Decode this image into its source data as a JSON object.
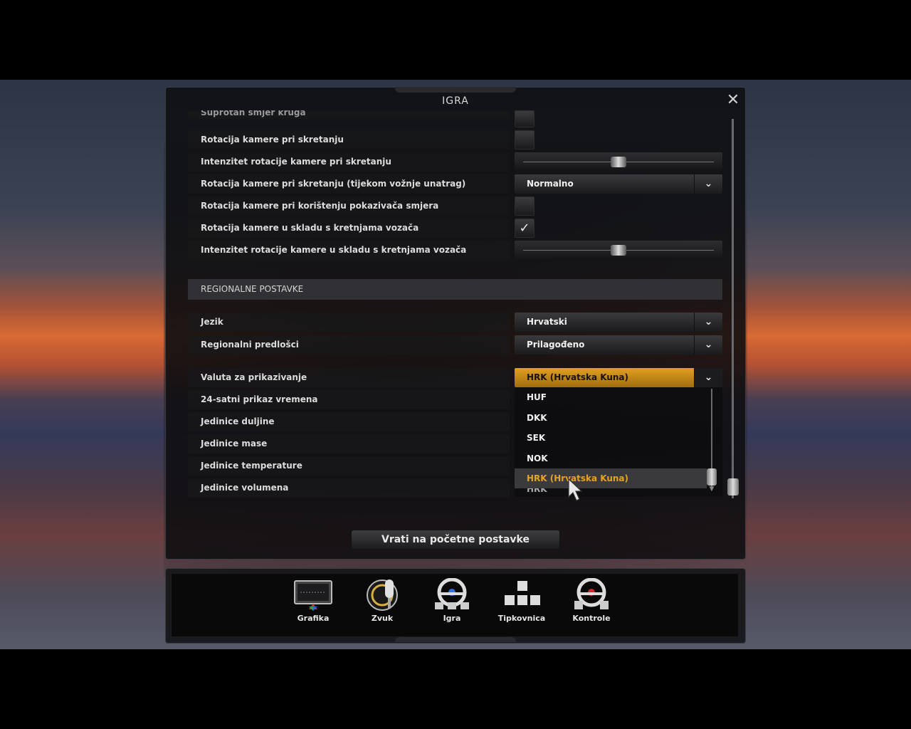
{
  "dialog": {
    "title": "IGRA",
    "close_label": "✕"
  },
  "rows": {
    "partial_label": "Suprotan smjer kruga",
    "camera_turn": "Rotacija kamere pri skretanju",
    "camera_turn_intensity": "Intenzitet rotacije kamere pri skretanju",
    "camera_turn_reverse": "Rotacija kamere pri skretanju (tijekom vožnje unatrag)",
    "camera_turn_reverse_value": "Normalno",
    "camera_blinker": "Rotacija kamere pri korištenju pokazivača smjera",
    "camera_driver_motion": "Rotacija kamere u skladu s kretnjama vozača",
    "camera_driver_motion_intensity": "Intenzitet rotacije kamere u skladu s kretnjama vozača"
  },
  "controls": {
    "camera_turn_checked": false,
    "camera_blinker_checked": false,
    "camera_driver_motion_checked": true,
    "camera_turn_intensity_level": 0.5,
    "camera_driver_motion_intensity_level": 0.5,
    "checkmark": "✓"
  },
  "regional": {
    "header": "REGIONALNE POSTAVKE",
    "language_label": "Jezik",
    "language_value": "Hrvatski",
    "templates_label": "Regionalni predlošci",
    "templates_value": "Prilagođeno",
    "currency_label": "Valuta za prikazivanje",
    "currency_value": "HRK (Hrvatska Kuna)",
    "time24_label": "24-satni prikaz vremena",
    "length_label": "Jedinice duljine",
    "mass_label": "Jedinice mase",
    "temperature_label": "Jedinice temperature",
    "volume_label": "Jedinice volumena"
  },
  "currency_dropdown": {
    "options": [
      "HUF",
      "DKK",
      "SEK",
      "NOK",
      "HRK (Hrvatska Kuna)"
    ],
    "cut_option": "HRK",
    "selected_index": 4
  },
  "reset_button": "Vrati na početne postavke",
  "nav": {
    "graphics": "Grafika",
    "sound": "Zvuk",
    "game": "Igra",
    "keyboard": "Tipkovnica",
    "controls": "Kontrole"
  },
  "colors": {
    "accent": "#e5a21e",
    "panel": "#0e0e10",
    "text": "#dcdcdc"
  },
  "arrow_glyph": "⌄"
}
